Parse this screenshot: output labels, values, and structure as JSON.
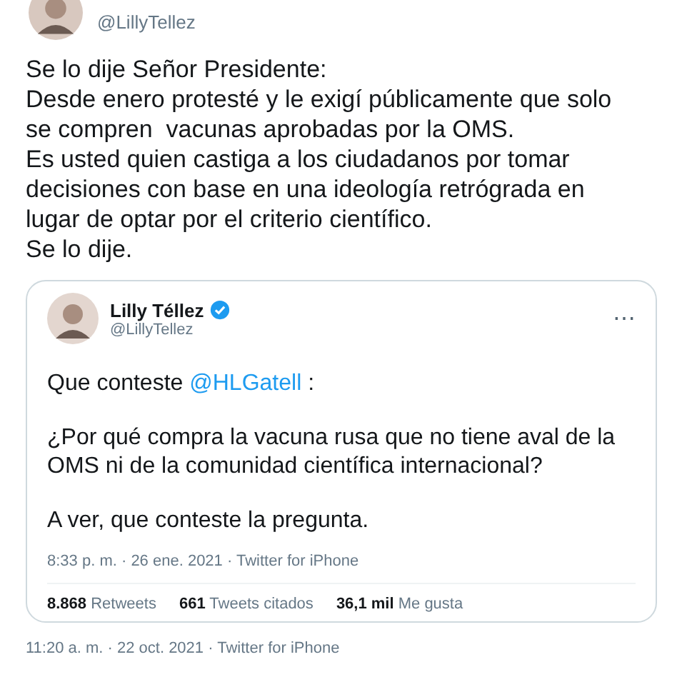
{
  "author": {
    "handle": "@LillyTellez"
  },
  "tweet_text": [
    "Se lo dije Señor Presidente:",
    "Desde enero protesté y le exigí públicamente que solo se compren  vacunas aprobadas por la OMS.",
    "Es usted quien castiga a los ciudadanos por tomar decisiones con base en una ideología retrógrada en lugar de optar por el criterio científico.",
    "Se lo dije."
  ],
  "quoted_tweet": {
    "name": "Lilly Téllez",
    "verified": true,
    "handle": "@LillyTellez",
    "more": "⋯",
    "text_lead": "Que conteste",
    "mention": "@HLGatell",
    "text_tail": " :",
    "paragraphs": [
      "¿Por qué compra la vacuna rusa que no tiene aval de la OMS ni de la comunidad científica internacional?",
      "A ver, que conteste la pregunta."
    ],
    "meta": "8:33 p. m. · 26 ene. 2021 · Twitter for iPhone",
    "stats": [
      "**8.868** Retweets",
      "**661** Tweets citados",
      "**36,1 mil** Me gusta"
    ]
  },
  "timestamp": "11:20 a. m. · 22 oct. 2021 · Twitter for iPhone"
}
